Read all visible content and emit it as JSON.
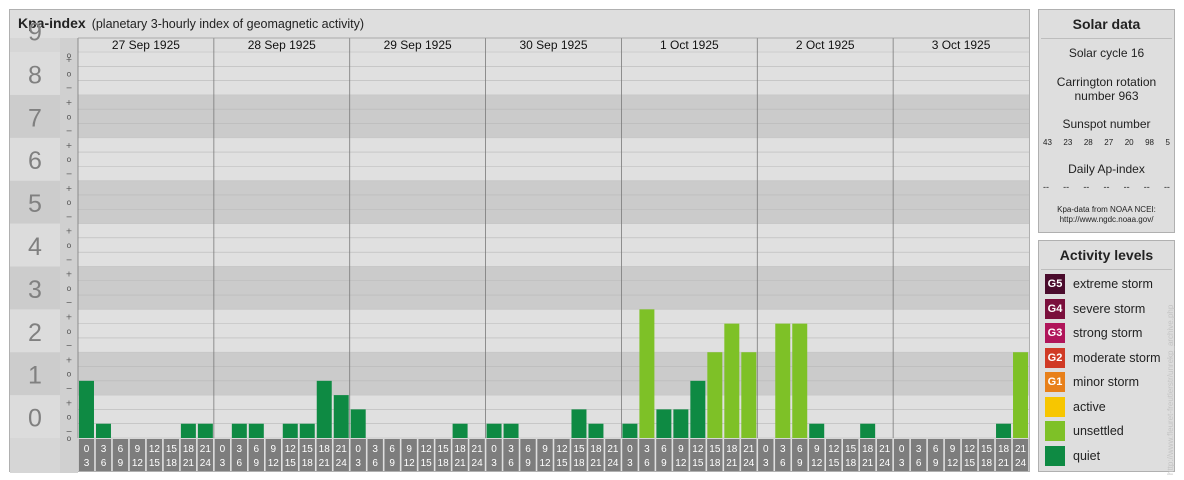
{
  "header": {
    "title": "Kpa-index",
    "subtitle": "(planetary 3-hourly index of geomagnetic activity)"
  },
  "chart_data": {
    "type": "bar",
    "title": "Kpa-index",
    "ylim": [
      0,
      9
    ],
    "y_major_ticks": [
      "0",
      "1",
      "2",
      "3",
      "4",
      "5",
      "6",
      "7",
      "8",
      "9"
    ],
    "y_minor_ticks": [
      "+",
      "o",
      "−"
    ],
    "days": [
      "27 Sep 1925",
      "28 Sep 1925",
      "29 Sep 1925",
      "30 Sep 1925",
      "1 Oct 1925",
      "2 Oct 1925",
      "3 Oct 1925"
    ],
    "interval_start": [
      "0",
      "3",
      "6",
      "9",
      "12",
      "15",
      "18",
      "21"
    ],
    "interval_end": [
      "3",
      "6",
      "9",
      "12",
      "15",
      "18",
      "21",
      "24"
    ],
    "colors": {
      "quiet": "#0e8a43",
      "unsettled": "#7ec127",
      "background_dark": "#cbcbcb",
      "background_light": "#e0e0e0"
    },
    "series": [
      {
        "day": "27 Sep 1925",
        "values": [
          1.333,
          0.333,
          0,
          0,
          0,
          0,
          0.333,
          0.333
        ]
      },
      {
        "day": "28 Sep 1925",
        "values": [
          0,
          0.333,
          0.333,
          0,
          0.333,
          0.333,
          1.333,
          1
        ]
      },
      {
        "day": "29 Sep 1925",
        "values": [
          0.667,
          0,
          0,
          0,
          0,
          0,
          0.333,
          0
        ]
      },
      {
        "day": "30 Sep 1925",
        "values": [
          0.333,
          0.333,
          0,
          0,
          0,
          0.667,
          0.333,
          0
        ]
      },
      {
        "day": "1 Oct 1925",
        "values": [
          0.333,
          3,
          0.667,
          0.667,
          1.333,
          2,
          2.667,
          2
        ]
      },
      {
        "day": "2 Oct 1925",
        "values": [
          0,
          2.667,
          2.667,
          0.333,
          0,
          0,
          0.333,
          0
        ]
      },
      {
        "day": "3 Oct 1925",
        "values": [
          0,
          0,
          0,
          0,
          0,
          0,
          0.333,
          2
        ]
      }
    ]
  },
  "solar": {
    "title": "Solar data",
    "cycle": "Solar cycle 16",
    "carrington_line1": "Carrington rotation",
    "carrington_line2": "number 963",
    "sunspot_title": "Sunspot number",
    "sunspots": [
      "43",
      "23",
      "28",
      "27",
      "20",
      "98",
      "5"
    ],
    "ap_title": "Daily Ap-index",
    "ap_values": [
      "--",
      "--",
      "--",
      "--",
      "--",
      "--",
      "--"
    ],
    "source_line1": "Kpa-data from NOAA NCEI:",
    "source_line2": "http://www.ngdc.noaa.gov/"
  },
  "activity": {
    "title": "Activity levels",
    "levels": [
      {
        "badge": "G5",
        "label": "extreme storm",
        "color": "#4a0b2c"
      },
      {
        "badge": "G4",
        "label": "severe storm",
        "color": "#7a0f3c"
      },
      {
        "badge": "G3",
        "label": "strong storm",
        "color": "#b0155a"
      },
      {
        "badge": "G2",
        "label": "moderate storm",
        "color": "#d03a25"
      },
      {
        "badge": "G1",
        "label": "minor storm",
        "color": "#e8801a"
      },
      {
        "badge": "",
        "label": "active",
        "color": "#f7c600"
      },
      {
        "badge": "",
        "label": "unsettled",
        "color": "#7ec127"
      },
      {
        "badge": "",
        "label": "quiet",
        "color": "#0e8a43"
      }
    ]
  },
  "credit": "http://www.fleuret-freutlerstr/unrekp_archive.php"
}
